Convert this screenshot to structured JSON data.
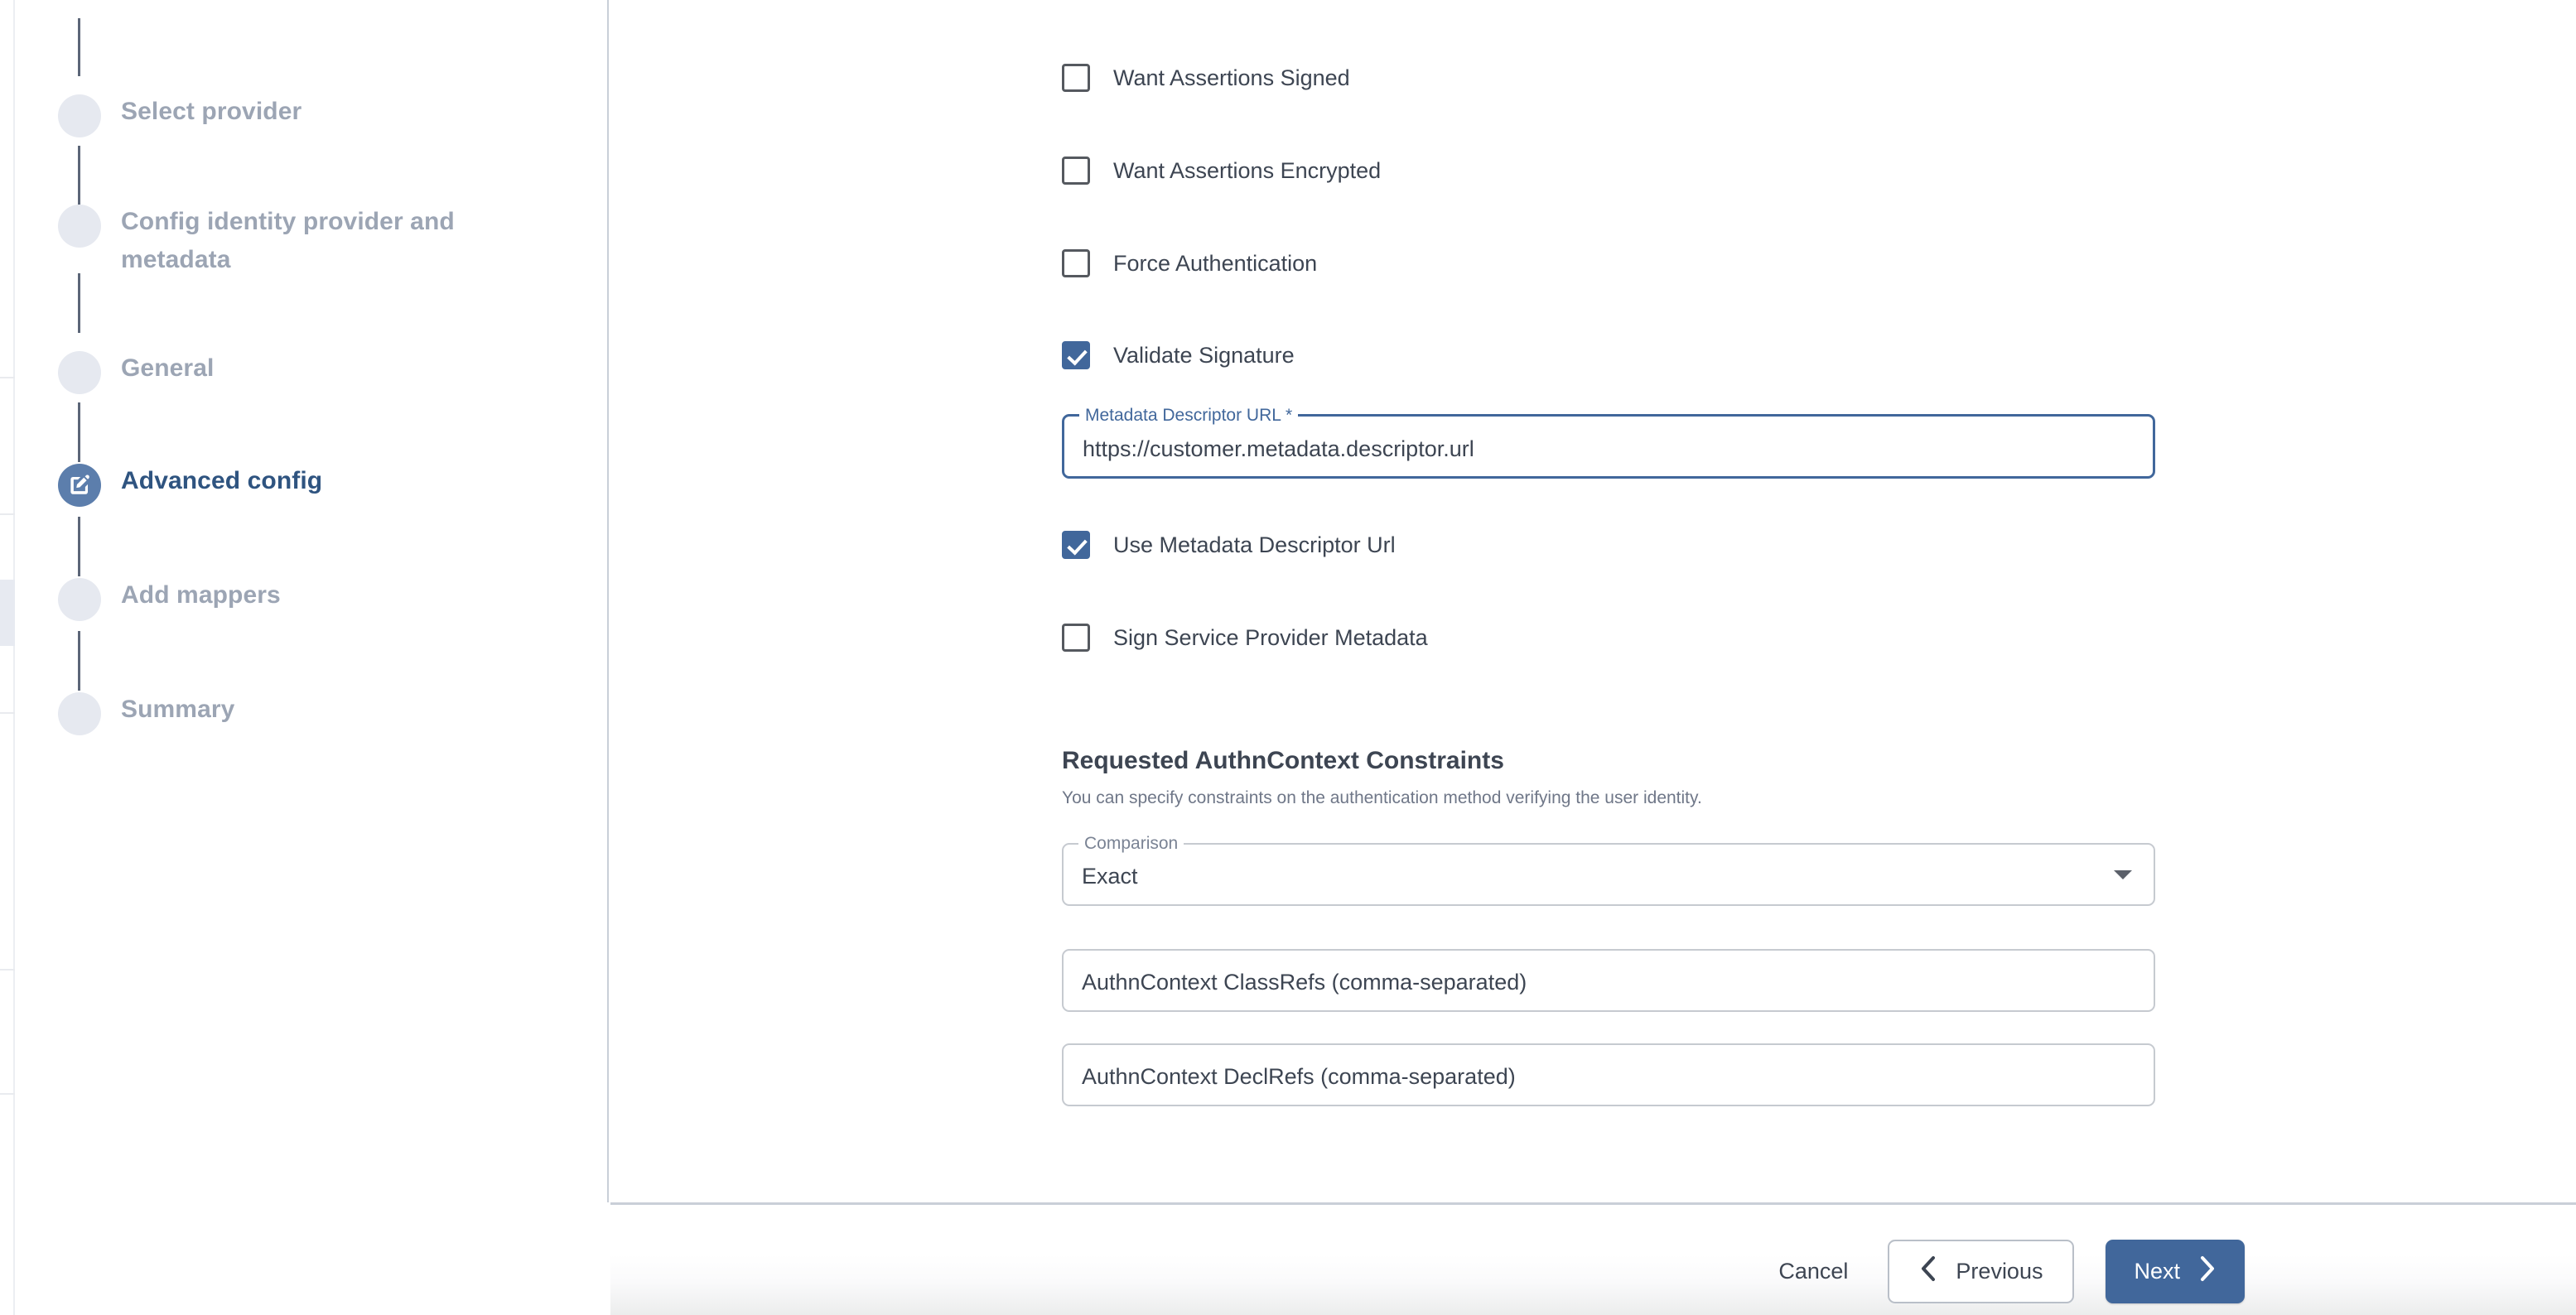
{
  "wizard": {
    "steps": [
      {
        "label": "Select provider",
        "state": "pending",
        "icon": "circle-icon"
      },
      {
        "label": "Config identity provider and metadata",
        "state": "pending",
        "icon": "circle-icon"
      },
      {
        "label": "General",
        "state": "pending",
        "icon": "circle-icon"
      },
      {
        "label": "Advanced config",
        "state": "active",
        "icon": "edit-square-icon"
      },
      {
        "label": "Add mappers",
        "state": "pending",
        "icon": "circle-icon"
      },
      {
        "label": "Summary",
        "state": "pending",
        "icon": "circle-icon"
      }
    ]
  },
  "form": {
    "checkboxes": [
      {
        "label": "Want Assertions Signed",
        "checked": false
      },
      {
        "label": "Want Assertions Encrypted",
        "checked": false
      },
      {
        "label": "Force Authentication",
        "checked": false
      },
      {
        "label": "Validate Signature",
        "checked": true
      }
    ],
    "metadata_url_field": {
      "label": "Metadata Descriptor URL *",
      "value": "https://customer.metadata.descriptor.url",
      "focused": true
    },
    "checkboxes_after": [
      {
        "label": "Use Metadata Descriptor Url",
        "checked": true
      },
      {
        "label": "Sign Service Provider Metadata",
        "checked": false
      }
    ],
    "authn_section": {
      "title": "Requested AuthnContext Constraints",
      "description": "You can specify constraints on the authentication method verifying the user identity."
    },
    "comparison_select": {
      "label": "Comparison",
      "value": "Exact",
      "caret_icon": "chevron-down-icon"
    },
    "classrefs_input": {
      "value": "AuthnContext ClassRefs (comma-separated)"
    },
    "declrefs_input": {
      "value": "AuthnContext DeclRefs (comma-separated)"
    }
  },
  "footer": {
    "cancel_label": "Cancel",
    "previous_label": "Previous",
    "next_label": "Next",
    "previous_icon": "chevron-left-icon",
    "next_icon": "chevron-right-icon"
  },
  "colors": {
    "accent_blue": "#41679b",
    "active_step_blue": "#5c7eac",
    "active_step_text": "#2f5480",
    "pending_step_text": "#9ca5b4",
    "pending_bullet": "#e6e9f0",
    "connector": "#5c6678",
    "text_primary": "#3d4552",
    "text_muted": "#6f7788",
    "border": "#c6cad0",
    "divider": "#c9cfd8"
  }
}
